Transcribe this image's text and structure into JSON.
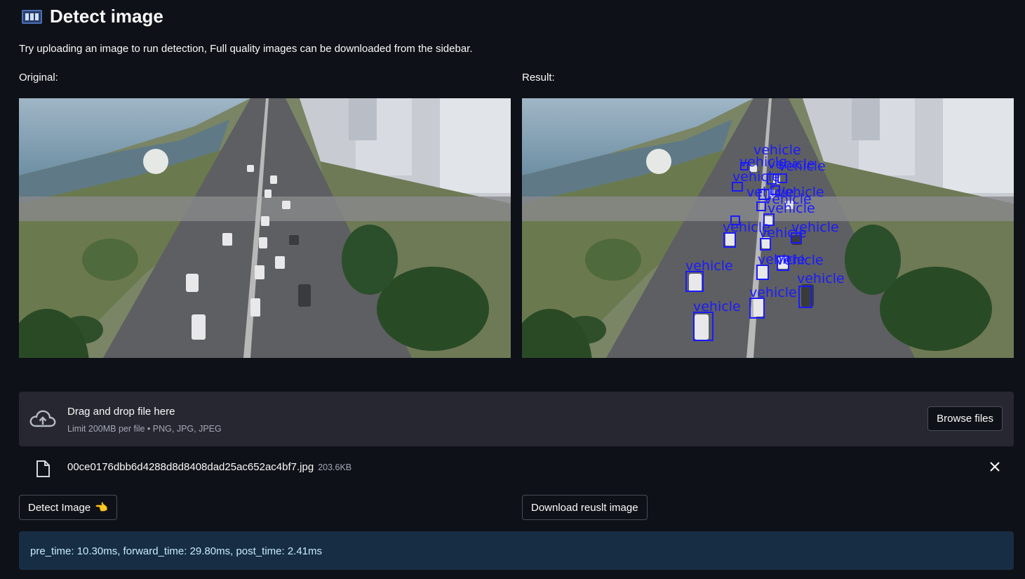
{
  "header": {
    "icon": "film-frames-icon",
    "title": "Detect image",
    "subtitle": "Try uploading an image to run detection, Full quality images can be downloaded from the sidebar."
  },
  "columns": {
    "original_label": "Original:",
    "result_label": "Result:"
  },
  "detections": {
    "label": "vehicle",
    "color": "#1a1aff"
  },
  "uploader": {
    "icon": "cloud-upload-icon",
    "title": "Drag and drop file here",
    "hint": "Limit 200MB per file • PNG, JPG, JPEG",
    "browse_label": "Browse files"
  },
  "file": {
    "icon": "file-icon",
    "name": "00ce0176dbb6d4288d8d8408dad25ac652ac4bf7.jpg",
    "size": "203.6KB",
    "remove_icon": "close-icon"
  },
  "actions": {
    "detect_label": "Detect Image",
    "detect_emoji": "👈",
    "download_label": "Download reuslt image"
  },
  "info": {
    "text": "pre_time: 10.30ms, forward_time: 29.80ms, post_time: 2.41ms"
  },
  "colors": {
    "background": "#0e1117",
    "panel": "#262730",
    "info_bg": "#172d43",
    "info_text": "#c7ebff"
  }
}
